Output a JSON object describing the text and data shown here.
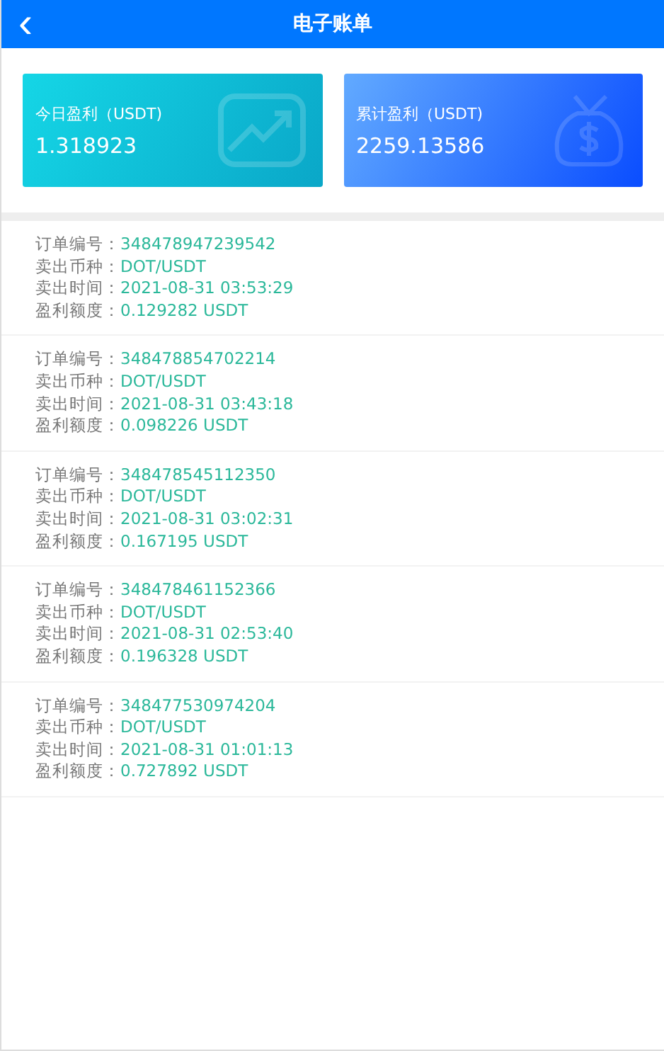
{
  "header": {
    "back": "‹",
    "title": "电子账单"
  },
  "cards": [
    {
      "kind": "trend",
      "label": "今日盈利（USDT)",
      "value": "1.318923"
    },
    {
      "kind": "bag",
      "label": "累计盈利（USDT)",
      "value": "2259.13586"
    }
  ],
  "orders": [
    {
      "fields": [
        {
          "label": "订单编号：",
          "value": "348478947239542"
        },
        {
          "label": "卖出币种：",
          "value": "DOT/USDT"
        },
        {
          "label": "卖出时间：",
          "value": "2021-08-31 03:53:29"
        },
        {
          "label": "盈利额度：",
          "value": "0.129282 USDT"
        }
      ]
    },
    {
      "fields": [
        {
          "label": "订单编号：",
          "value": "348478854702214"
        },
        {
          "label": "卖出币种：",
          "value": "DOT/USDT"
        },
        {
          "label": "卖出时间：",
          "value": "2021-08-31 03:43:18"
        },
        {
          "label": "盈利额度：",
          "value": "0.098226 USDT"
        }
      ]
    },
    {
      "fields": [
        {
          "label": "订单编号：",
          "value": "348478545112350"
        },
        {
          "label": "卖出币种：",
          "value": "DOT/USDT"
        },
        {
          "label": "卖出时间：",
          "value": "2021-08-31 03:02:31"
        },
        {
          "label": "盈利额度：",
          "value": "0.167195 USDT"
        }
      ]
    },
    {
      "fields": [
        {
          "label": "订单编号：",
          "value": "348478461152366"
        },
        {
          "label": "卖出币种：",
          "value": "DOT/USDT"
        },
        {
          "label": "卖出时间：",
          "value": "2021-08-31 02:53:40"
        },
        {
          "label": "盈利额度：",
          "value": "0.196328 USDT"
        }
      ]
    },
    {
      "fields": [
        {
          "label": "订单编号：",
          "value": "348477530974204"
        },
        {
          "label": "卖出币种：",
          "value": "DOT/USDT"
        },
        {
          "label": "卖出时间：",
          "value": "2021-08-31 01:01:13"
        },
        {
          "label": "盈利额度：",
          "value": "0.727892 USDT"
        }
      ]
    }
  ]
}
